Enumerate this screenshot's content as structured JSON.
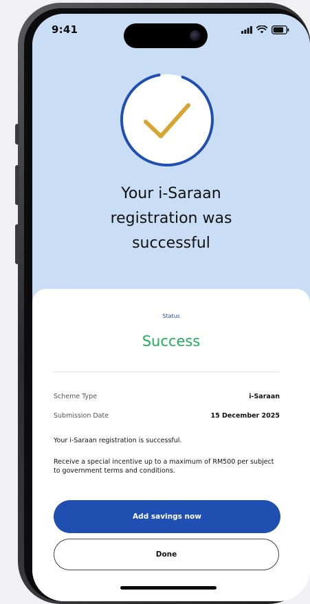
{
  "status_bar": {
    "time": "9:41"
  },
  "hero": {
    "title": "Your i-Saraan\nregistration was\nsuccessful",
    "icon": "checkmark-icon"
  },
  "result": {
    "status_label": "Status",
    "status_value": "Success"
  },
  "details": [
    {
      "label": "Scheme Type",
      "value": "i-Saraan"
    },
    {
      "label": "Submission Date",
      "value": "15 December 2025"
    }
  ],
  "info": {
    "line1": "Your i-Saraan registration is successful.",
    "line2": "Receive a special incentive up to a maximum of RM500 per subject to government terms and conditions."
  },
  "actions": {
    "primary_label": "Add savings now",
    "secondary_label": "Done"
  },
  "colors": {
    "hero_bg": "#c9def4",
    "accent_blue": "#1f4fb0",
    "success_green": "#1fae57",
    "check_gold": "#d7a531"
  }
}
